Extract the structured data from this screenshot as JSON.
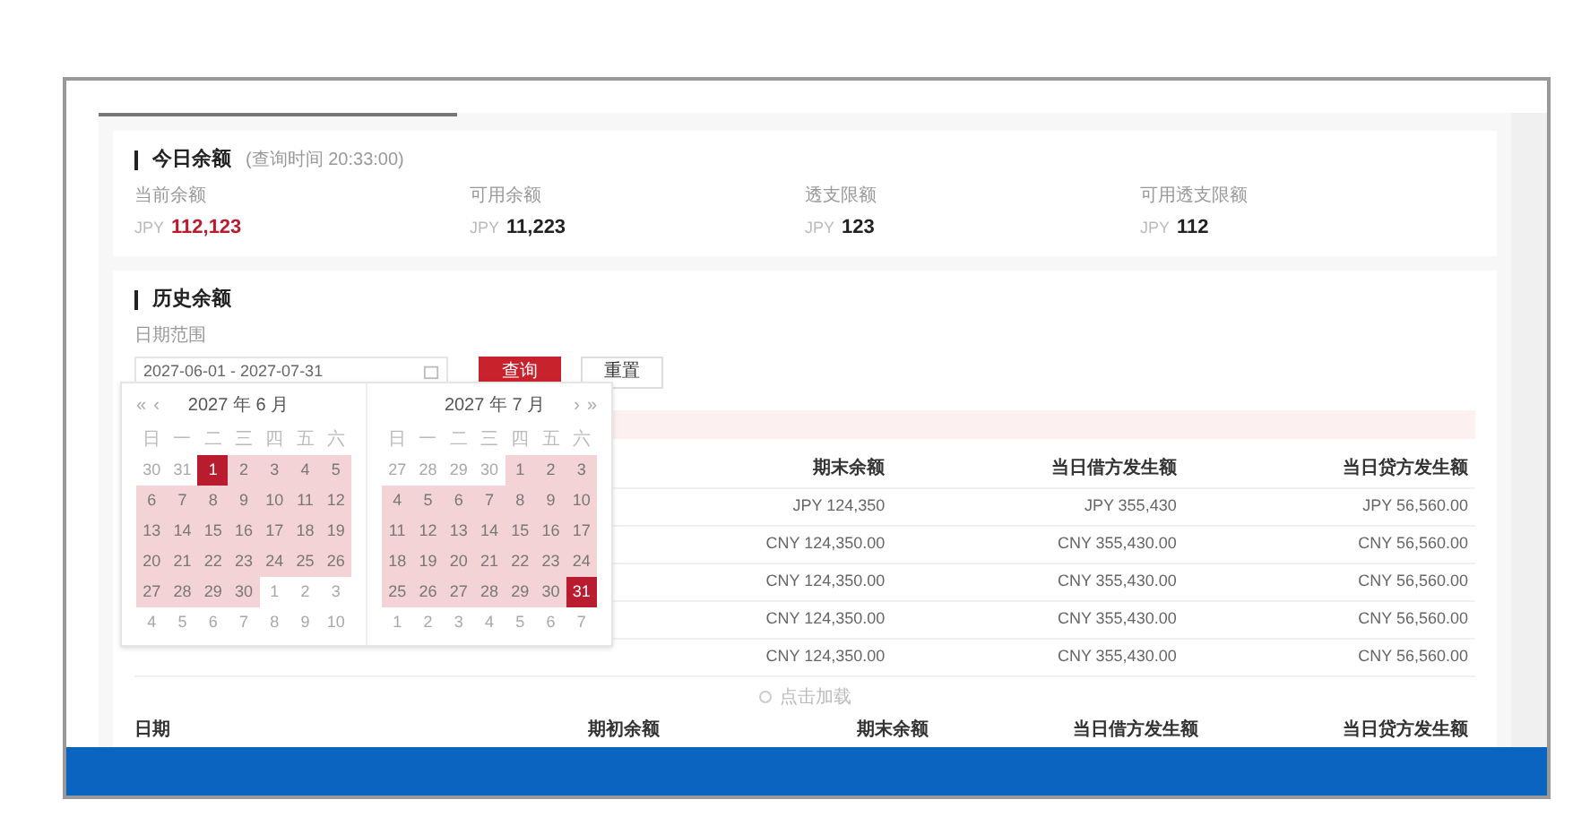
{
  "today": {
    "title": "今日余额",
    "query_time": "(查询时间 20:33:00)",
    "items": [
      {
        "label": "当前余额",
        "currency": "JPY",
        "value": "112,123",
        "highlight": true
      },
      {
        "label": "可用余额",
        "currency": "JPY",
        "value": "11,223",
        "highlight": false
      },
      {
        "label": "透支限额",
        "currency": "JPY",
        "value": "123",
        "highlight": false
      },
      {
        "label": "可用透支限额",
        "currency": "JPY",
        "value": "112",
        "highlight": false
      }
    ]
  },
  "history": {
    "title": "历史余额",
    "date_label": "日期范围",
    "date_value": "2027-06-01 - 2027-07-31",
    "query_button": "查询",
    "reset_button": "重置",
    "calendar": {
      "months": [
        {
          "title": "2027 年 6 月",
          "nav": [
            "«",
            "‹"
          ],
          "weekdays": [
            "日",
            "一",
            "二",
            "三",
            "四",
            "五",
            "六"
          ],
          "days": [
            {
              "label": "30",
              "kind": "muted"
            },
            {
              "label": "31",
              "kind": "muted"
            },
            {
              "label": "1",
              "kind": "edge"
            },
            {
              "label": "2",
              "kind": "range"
            },
            {
              "label": "3",
              "kind": "range"
            },
            {
              "label": "4",
              "kind": "range"
            },
            {
              "label": "5",
              "kind": "range"
            },
            {
              "label": "6",
              "kind": "range"
            },
            {
              "label": "7",
              "kind": "range"
            },
            {
              "label": "8",
              "kind": "range"
            },
            {
              "label": "9",
              "kind": "range"
            },
            {
              "label": "10",
              "kind": "range"
            },
            {
              "label": "11",
              "kind": "range"
            },
            {
              "label": "12",
              "kind": "range"
            },
            {
              "label": "13",
              "kind": "range"
            },
            {
              "label": "14",
              "kind": "range"
            },
            {
              "label": "15",
              "kind": "range"
            },
            {
              "label": "16",
              "kind": "range"
            },
            {
              "label": "17",
              "kind": "range"
            },
            {
              "label": "18",
              "kind": "range"
            },
            {
              "label": "19",
              "kind": "range"
            },
            {
              "label": "20",
              "kind": "range"
            },
            {
              "label": "21",
              "kind": "range"
            },
            {
              "label": "22",
              "kind": "range"
            },
            {
              "label": "23",
              "kind": "range"
            },
            {
              "label": "24",
              "kind": "range"
            },
            {
              "label": "25",
              "kind": "range"
            },
            {
              "label": "26",
              "kind": "range"
            },
            {
              "label": "27",
              "kind": "range"
            },
            {
              "label": "28",
              "kind": "range"
            },
            {
              "label": "29",
              "kind": "range"
            },
            {
              "label": "30",
              "kind": "range"
            },
            {
              "label": "1",
              "kind": "muted"
            },
            {
              "label": "2",
              "kind": "muted"
            },
            {
              "label": "3",
              "kind": "muted"
            },
            {
              "label": "4",
              "kind": "muted"
            },
            {
              "label": "5",
              "kind": "muted"
            },
            {
              "label": "6",
              "kind": "muted"
            },
            {
              "label": "7",
              "kind": "muted"
            },
            {
              "label": "8",
              "kind": "muted"
            },
            {
              "label": "9",
              "kind": "muted"
            },
            {
              "label": "10",
              "kind": "muted"
            }
          ]
        },
        {
          "title": "2027 年 7 月",
          "nav": [
            "›",
            "»"
          ],
          "weekdays": [
            "日",
            "一",
            "二",
            "三",
            "四",
            "五",
            "六"
          ],
          "days": [
            {
              "label": "27",
              "kind": "muted"
            },
            {
              "label": "28",
              "kind": "muted"
            },
            {
              "label": "29",
              "kind": "muted"
            },
            {
              "label": "30",
              "kind": "muted"
            },
            {
              "label": "1",
              "kind": "range"
            },
            {
              "label": "2",
              "kind": "range"
            },
            {
              "label": "3",
              "kind": "range"
            },
            {
              "label": "4",
              "kind": "range"
            },
            {
              "label": "5",
              "kind": "range"
            },
            {
              "label": "6",
              "kind": "range"
            },
            {
              "label": "7",
              "kind": "range"
            },
            {
              "label": "8",
              "kind": "range"
            },
            {
              "label": "9",
              "kind": "range"
            },
            {
              "label": "10",
              "kind": "range"
            },
            {
              "label": "11",
              "kind": "range"
            },
            {
              "label": "12",
              "kind": "range"
            },
            {
              "label": "13",
              "kind": "range"
            },
            {
              "label": "14",
              "kind": "range"
            },
            {
              "label": "15",
              "kind": "range"
            },
            {
              "label": "16",
              "kind": "range"
            },
            {
              "label": "17",
              "kind": "range"
            },
            {
              "label": "18",
              "kind": "range"
            },
            {
              "label": "19",
              "kind": "range"
            },
            {
              "label": "20",
              "kind": "range"
            },
            {
              "label": "21",
              "kind": "range"
            },
            {
              "label": "22",
              "kind": "range"
            },
            {
              "label": "23",
              "kind": "range"
            },
            {
              "label": "24",
              "kind": "range"
            },
            {
              "label": "25",
              "kind": "range"
            },
            {
              "label": "26",
              "kind": "range"
            },
            {
              "label": "27",
              "kind": "range"
            },
            {
              "label": "28",
              "kind": "range"
            },
            {
              "label": "29",
              "kind": "range"
            },
            {
              "label": "30",
              "kind": "range"
            },
            {
              "label": "31",
              "kind": "edge"
            },
            {
              "label": "1",
              "kind": "muted"
            },
            {
              "label": "2",
              "kind": "muted"
            },
            {
              "label": "3",
              "kind": "muted"
            },
            {
              "label": "4",
              "kind": "muted"
            },
            {
              "label": "5",
              "kind": "muted"
            },
            {
              "label": "6",
              "kind": "muted"
            },
            {
              "label": "7",
              "kind": "muted"
            }
          ]
        }
      ]
    },
    "table": {
      "columns": [
        "期末余额",
        "当日借方发生额",
        "当日贷方发生额"
      ],
      "rows": [
        [
          "JPY 124,350",
          "JPY 355,430",
          "JPY 56,560.00"
        ],
        [
          "CNY 124,350.00",
          "CNY 355,430.00",
          "CNY 56,560.00"
        ],
        [
          "CNY 124,350.00",
          "CNY 355,430.00",
          "CNY 56,560.00"
        ],
        [
          "CNY 124,350.00",
          "CNY 355,430.00",
          "CNY 56,560.00"
        ],
        [
          "CNY 124,350.00",
          "CNY 355,430.00",
          "CNY 56,560.00"
        ]
      ]
    },
    "load_more": "点击加载",
    "footer_columns": [
      "日期",
      "期初余额",
      "期末余额",
      "当日借方发生额",
      "当日贷方发生额"
    ]
  }
}
